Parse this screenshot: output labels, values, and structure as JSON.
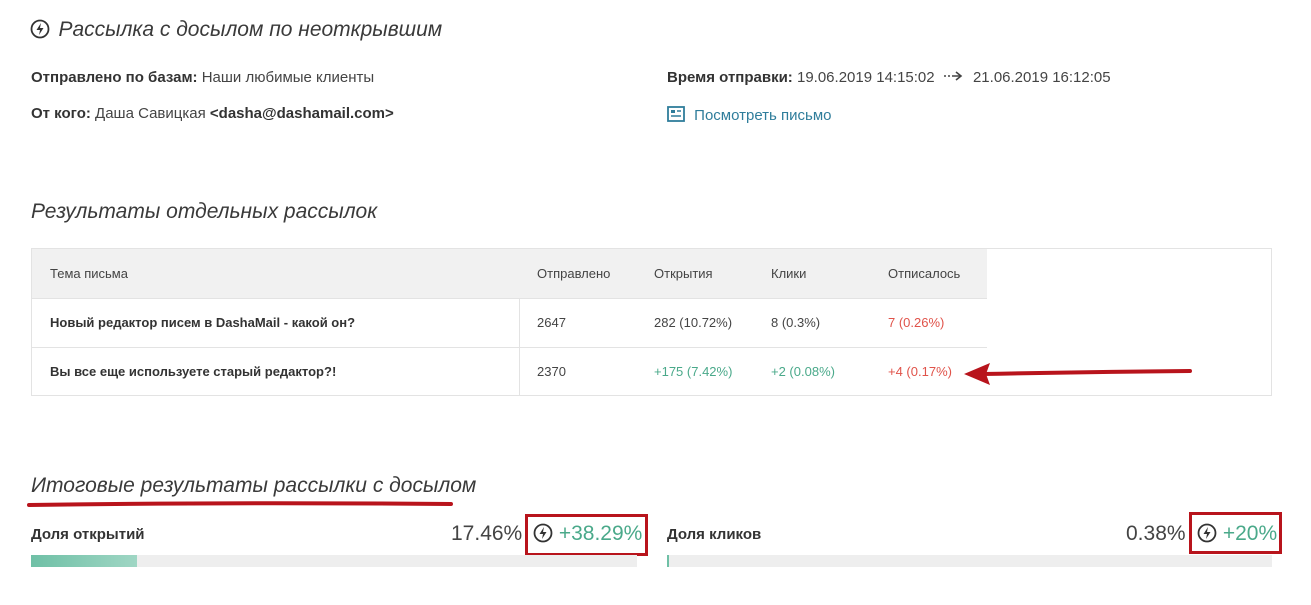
{
  "header": {
    "title": "Рассылка с досылом по неоткрывшим",
    "bases_label": "Отправлено по базам:",
    "bases_value": "Наши любимые клиенты",
    "from_label": "От кого:",
    "from_name": "Даша Савицкая",
    "from_email": "<dasha@dashamail.com>",
    "time_label": "Время отправки:",
    "time_start": "19.06.2019 14:15:02",
    "time_end": "21.06.2019 16:12:05",
    "view_link": "Посмотреть письмо"
  },
  "results": {
    "title": "Результаты отдельных рассылок",
    "columns": [
      "Тема письма",
      "Отправлено",
      "Открытия",
      "Клики",
      "Отписалось"
    ],
    "rows": [
      {
        "subject": "Новый редактор писем в DashaMail - какой он?",
        "sent": "2647",
        "opens": "282 (10.72%)",
        "clicks": "8 (0.3%)",
        "unsub": "7 (0.26%)"
      },
      {
        "subject": "Вы все еще используете старый редактор?!",
        "sent": "2370",
        "opens": "+175 (7.42%)",
        "clicks": "+2 (0.08%)",
        "unsub": "+4 (0.17%)"
      }
    ]
  },
  "totals": {
    "title": "Итоговые результаты рассылки с досылом",
    "opens_label": "Доля открытий",
    "opens_value": "17.46%",
    "opens_delta": "+38.29%",
    "opens_fraction": 0.1746,
    "clicks_label": "Доля кликов",
    "clicks_value": "0.38%",
    "clicks_delta": "+20%",
    "clicks_fraction": 0.0038
  },
  "colors": {
    "accent_green": "#4aa98a",
    "accent_red": "#e0534a",
    "annotation_red": "#b8141c",
    "link": "#2f7d9b"
  }
}
